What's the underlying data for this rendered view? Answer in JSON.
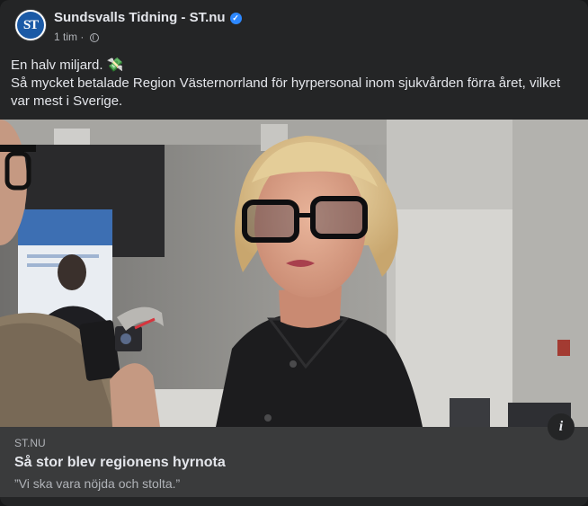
{
  "post": {
    "page_name": "Sundsvalls Tidning - ST.nu",
    "avatar_text": "ST",
    "verified_icon": "verified-badge-icon",
    "time": "1 tim",
    "separator": "·",
    "privacy_icon": "globe-icon",
    "text_line1": "En halv miljard. 💸",
    "text_line2": "Så mycket betalade Region Västernorrland för hyrpersonal inom sjukvården förra året, vilket var mest i Sverige."
  },
  "link": {
    "domain": "ST.NU",
    "title": "Så stor blev regionens hyrnota",
    "description": "”Vi ska vara nöjda och stolta.”",
    "info_label": "i"
  },
  "colors": {
    "card_bg": "#242526",
    "link_bg": "#3a3b3c",
    "text_primary": "#e4e6eb",
    "text_secondary": "#b0b3b8",
    "verified": "#2d88ff",
    "avatar": "#1b5aa6"
  }
}
